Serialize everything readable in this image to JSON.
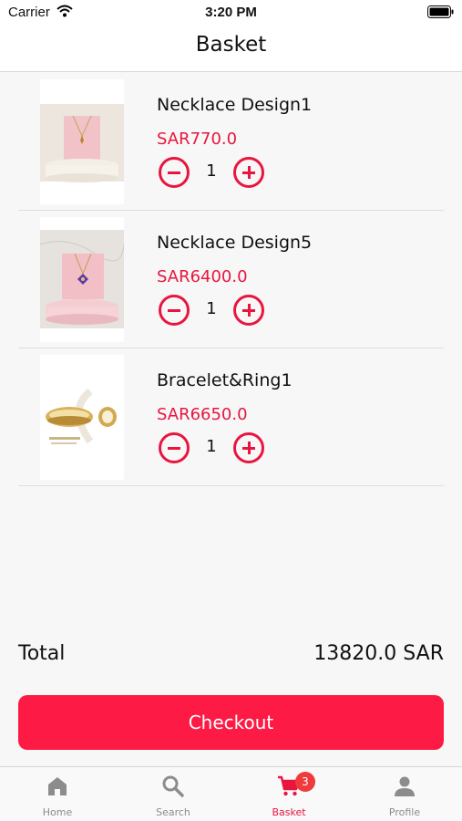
{
  "status_bar": {
    "carrier": "Carrier",
    "time": "3:20 PM"
  },
  "header": {
    "title": "Basket"
  },
  "cart": {
    "items": [
      {
        "name": "Necklace Design1",
        "price": "SAR770.0",
        "quantity": "1",
        "image": "necklace-pendant-photo"
      },
      {
        "name": "Necklace Design5",
        "price": "SAR6400.0",
        "quantity": "1",
        "image": "necklace-pendant-photo"
      },
      {
        "name": "Bracelet&Ring1",
        "price": "SAR6650.0",
        "quantity": "1",
        "image": "bracelet-ring-photo"
      }
    ]
  },
  "summary": {
    "total_label": "Total",
    "total_value": "13820.0 SAR"
  },
  "checkout": {
    "label": "Checkout"
  },
  "tab_bar": {
    "tabs": [
      {
        "label": "Home",
        "icon": "home-icon"
      },
      {
        "label": "Search",
        "icon": "search-icon"
      },
      {
        "label": "Basket",
        "icon": "cart-icon",
        "badge": "3",
        "active": true
      },
      {
        "label": "Profile",
        "icon": "person-icon"
      }
    ]
  },
  "colors": {
    "accent": "#fd1a44",
    "price": "#e8163f",
    "background": "#f7f7f7"
  }
}
